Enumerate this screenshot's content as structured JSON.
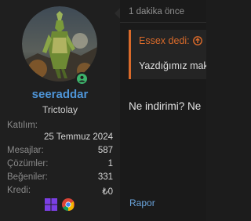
{
  "user": {
    "username": "seeraddar",
    "title": "Trictolay",
    "stats": {
      "joined_label": "Katılım:",
      "joined_value": "25 Temmuz 2024",
      "messages_label": "Mesajlar:",
      "messages_value": "587",
      "solutions_label": "Çözümler:",
      "solutions_value": "1",
      "likes_label": "Beğeniler:",
      "likes_value": "331",
      "credits_label": "Kredi:",
      "credits_value": "₺0"
    },
    "badges": [
      "windows-icon",
      "chrome-icon"
    ],
    "online_color": "#3db36b"
  },
  "post": {
    "time": "1 dakika önce",
    "quote_author": "Essex dedi:",
    "quote_text": "Yazdığımız mak",
    "message": "Ne indirimi? Ne",
    "report_label": "Rapor"
  },
  "colors": {
    "username": "#4e95d8",
    "quote_accent": "#d96a2a",
    "link": "#6aa4dc"
  }
}
